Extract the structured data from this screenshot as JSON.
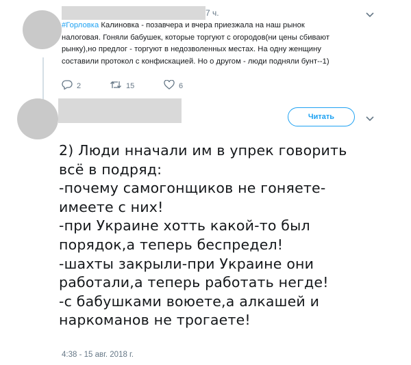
{
  "tweet1": {
    "time": "7 ч.",
    "hashtag": "#Горловка",
    "text_lines": [
      " Калиновка - позавчера и вчера приезжала  на наш рынок",
      "налоговая. Гоняли бабушек, которые торгуют с огородов(ни цены сбивают",
      "рынку),но предлог - торгуют в недозволенных местах. На одну женщину",
      "составили протокол с конфискацией. Но  о другом - люди подняли бунт--1)"
    ],
    "reply_count": "2",
    "retweet_count": "15",
    "like_count": "6",
    "menu_icon": "chevron-down-icon"
  },
  "tweet2": {
    "follow_label": "Читать",
    "text": "2) Люди нначали им в упрек говорить\nвсё в подряд:\n-почему самогонщиков не гоняете-\nимеете с них!\n-при Украине хотть какой-то был\nпорядок,а теперь беспредел!\n-шахты закрыли-при Украине они\nработали,а теперь работать негде!\n-с бабушками воюете,а алкашей и\nнаркоманов не трогаете!",
    "timestamp": "4:38 - 15 авг. 2018 г.",
    "menu_icon": "chevron-down-icon"
  },
  "colors": {
    "accent": "#1da1f2",
    "muted": "#657786",
    "redaction": "#d9d9d9",
    "avatar": "#c9c9c9"
  }
}
